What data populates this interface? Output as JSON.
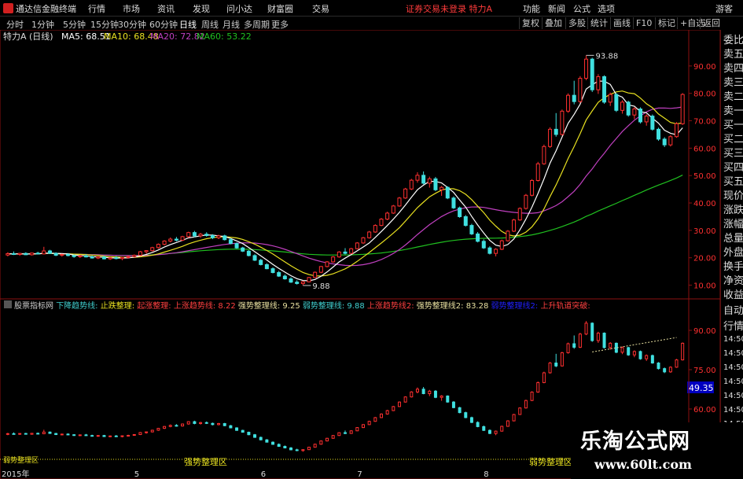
{
  "app": {
    "name": "通达信金融终端",
    "login_warning": "证券交易未登录 特力A"
  },
  "menu": [
    "行情",
    "市场",
    "资讯",
    "发现",
    "问小达",
    "财富圈",
    "交易"
  ],
  "menu_right": [
    "功能",
    "新闻",
    "公式",
    "选项",
    "游客"
  ],
  "periods": [
    "分时",
    "1分钟",
    "5分钟",
    "15分钟",
    "30分钟",
    "60分钟",
    "日线",
    "周线",
    "月线",
    "多周期",
    "更多"
  ],
  "active_period": "日线",
  "toolbar_right": [
    "复权",
    "叠加",
    "多股",
    "统计",
    "画线",
    "F10",
    "标记",
    "+自选",
    "返回"
  ],
  "right_panel": [
    "委比",
    "卖五",
    "卖四",
    "卖三",
    "卖二",
    "卖一",
    "买一",
    "买二",
    "买三",
    "买四",
    "买五",
    "现价",
    "涨跌",
    "涨幅",
    "总量",
    "外盘",
    "换手",
    "净资",
    "收益",
    "自动",
    "行情",
    "14:50",
    "14:50",
    "14:50",
    "14:50",
    "14:50",
    "14:50",
    "14:50",
    "14:50"
  ],
  "main_legend": {
    "stock": "特力A",
    "period": "(日线)",
    "ma5": "MA5: 68.51",
    "ma10": "MA10: 68.48",
    "ma20": "MA20: 72.82",
    "ma60": "MA60: 53.22"
  },
  "sub_legend": [
    {
      "text": "股票指标网",
      "color": "#c8c8c8"
    },
    {
      "text": "下降趋势线: ",
      "color": "#40d0d0"
    },
    {
      "text": "止跌整理: ",
      "color": "#e8e020"
    },
    {
      "text": "起涨整理: ",
      "color": "#ff4040"
    },
    {
      "text": "上涨趋势线: 8.22",
      "color": "#ff4040"
    },
    {
      "text": "强势整理线: 9.25",
      "color": "#e8e0a0"
    },
    {
      "text": "弱势整理线: 9.88",
      "color": "#40d0d0"
    },
    {
      "text": "上涨趋势线2: ",
      "color": "#ff4040"
    },
    {
      "text": "强势整理线2: 83.28",
      "color": "#e8e0a0"
    },
    {
      "text": "弱势整理线2: ",
      "color": "#2020ff"
    },
    {
      "text": "上升轨道突破: ",
      "color": "#ff4040"
    }
  ],
  "sub_labels": {
    "left_bottom": "弱势整理区",
    "mid_bottom": "强势整理区",
    "right_bottom": "弱势整理区",
    "value_box": "49.35"
  },
  "watermark": {
    "title": "乐淘公式网",
    "url": "www.60lt.com"
  },
  "colors": {
    "up": "#ff3030",
    "down": "#40e0e0",
    "ma5": "#ffffff",
    "ma10": "#e8e020",
    "ma20": "#c040c0",
    "ma60": "#20c020",
    "axis": "#8b1010",
    "axis_text": "#ff3030"
  },
  "chart_data": {
    "type": "candlestick",
    "main": {
      "y_ticks": [
        10,
        20,
        30,
        40,
        50,
        60,
        70,
        80,
        90
      ],
      "ylim": [
        7,
        98
      ],
      "annotations": [
        {
          "label": "93.88",
          "x": 96,
          "y": 93.88
        },
        {
          "label": "9.88",
          "x": 49,
          "y": 9.88
        }
      ],
      "ohlc": [
        [
          21,
          22,
          20.5,
          21.5
        ],
        [
          21.5,
          22.3,
          21,
          21.2
        ],
        [
          21.2,
          21.8,
          20.7,
          21.6
        ],
        [
          21.6,
          22,
          21,
          21.1
        ],
        [
          21.1,
          21.9,
          20.8,
          21.7
        ],
        [
          21.7,
          22.2,
          21.2,
          21.4
        ],
        [
          21.4,
          24,
          21.2,
          22.5
        ],
        [
          22.5,
          22.9,
          21.4,
          21.6
        ],
        [
          21.6,
          22,
          20.6,
          20.9
        ],
        [
          20.9,
          21.5,
          20.4,
          21.2
        ],
        [
          21.2,
          21.7,
          20.5,
          20.8
        ],
        [
          20.8,
          21.2,
          20,
          20.4
        ],
        [
          20.4,
          21,
          19.9,
          20.7
        ],
        [
          20.7,
          21.3,
          20.1,
          20.3
        ],
        [
          20.3,
          20.8,
          19.7,
          19.9
        ],
        [
          19.9,
          20.6,
          19.5,
          20.3
        ],
        [
          20.3,
          20.7,
          19.4,
          19.6
        ],
        [
          19.6,
          20.3,
          19.2,
          20
        ],
        [
          20,
          20.6,
          19.4,
          19.7
        ],
        [
          19.7,
          20.3,
          19.1,
          20.1
        ],
        [
          20.1,
          20.8,
          19.7,
          20.4
        ],
        [
          20.4,
          21.2,
          20.1,
          20.9
        ],
        [
          20.9,
          22.5,
          20.6,
          22.2
        ],
        [
          22.2,
          22.8,
          21.5,
          22.6
        ],
        [
          22.6,
          24,
          22.3,
          23.7
        ],
        [
          23.7,
          25.2,
          23.3,
          24.9
        ],
        [
          24.9,
          26.4,
          24.5,
          26.1
        ],
        [
          26.1,
          27.4,
          25.6,
          26.8
        ],
        [
          26.8,
          27.6,
          26,
          26.4
        ],
        [
          26.4,
          28,
          26.1,
          27.7
        ],
        [
          27.7,
          29.5,
          27.3,
          29.2
        ],
        [
          29.2,
          29.8,
          27.5,
          28
        ],
        [
          28,
          29.1,
          27.3,
          28.6
        ],
        [
          28.6,
          29.3,
          27.7,
          28.1
        ],
        [
          28.1,
          28.6,
          26.8,
          27.3
        ],
        [
          27.3,
          28.4,
          26.8,
          28
        ],
        [
          28,
          28.4,
          26.3,
          26.6
        ],
        [
          26.6,
          27.1,
          24.9,
          25.2
        ],
        [
          25.2,
          25.6,
          23.3,
          23.6
        ],
        [
          23.6,
          24,
          22.1,
          22.4
        ],
        [
          22.4,
          22.8,
          20.5,
          20.8
        ],
        [
          20.8,
          21.3,
          18.8,
          19.1
        ],
        [
          19.1,
          19.6,
          17.2,
          17.5
        ],
        [
          17.5,
          18,
          15.8,
          16
        ],
        [
          16,
          16.5,
          14.3,
          14.6
        ],
        [
          14.6,
          15.2,
          13,
          13.3
        ],
        [
          13.3,
          13.9,
          12,
          12.3
        ],
        [
          12.3,
          12.9,
          10.8,
          11.1
        ],
        [
          11.1,
          11.8,
          10.2,
          10.6
        ],
        [
          10.6,
          11.5,
          9.88,
          11.2
        ],
        [
          11.2,
          13,
          11,
          12.8
        ],
        [
          12.8,
          15,
          12.6,
          14.7
        ],
        [
          14.7,
          17,
          14.4,
          16.8
        ],
        [
          16.8,
          18.8,
          16.5,
          18.5
        ],
        [
          18.5,
          20.6,
          18.2,
          20.3
        ],
        [
          20.3,
          22.4,
          20,
          22.1
        ],
        [
          22.1,
          23.5,
          21.2,
          21.6
        ],
        [
          21.6,
          23.6,
          21.4,
          23.3
        ],
        [
          23.3,
          25.7,
          23.1,
          25.4
        ],
        [
          25.4,
          27.6,
          25.1,
          27.3
        ],
        [
          27.3,
          29.8,
          27,
          29.4
        ],
        [
          29.4,
          32.2,
          29.1,
          31.8
        ],
        [
          31.8,
          34.5,
          31.5,
          34.1
        ],
        [
          34.1,
          36.8,
          33.7,
          36.3
        ],
        [
          36.3,
          39.3,
          36,
          38.9
        ],
        [
          38.9,
          42.2,
          38.6,
          41.8
        ],
        [
          41.8,
          45.5,
          41.5,
          45.1
        ],
        [
          45.1,
          48.8,
          44.7,
          48.3
        ],
        [
          48.3,
          51.2,
          47.4,
          50.1
        ],
        [
          50.1,
          51.5,
          46.8,
          47.2
        ],
        [
          47.2,
          49.6,
          45.6,
          48.8
        ],
        [
          48.8,
          49.5,
          44.3,
          44.8
        ],
        [
          44.8,
          46.2,
          42.6,
          45.7
        ],
        [
          45.7,
          46.1,
          41.4,
          41.8
        ],
        [
          41.8,
          42.4,
          37.8,
          38.2
        ],
        [
          38.2,
          38.7,
          34.6,
          35
        ],
        [
          35,
          35.6,
          31.4,
          31.8
        ],
        [
          31.8,
          32.4,
          28.3,
          28.7
        ],
        [
          28.7,
          29.4,
          25.6,
          26
        ],
        [
          26,
          26.7,
          23.2,
          23.6
        ],
        [
          23.6,
          24.2,
          21.2,
          21.6
        ],
        [
          21.6,
          23.5,
          20.5,
          23.1
        ],
        [
          23.1,
          26.6,
          22.8,
          26.2
        ],
        [
          26.2,
          30.1,
          25.9,
          29.7
        ],
        [
          29.7,
          34.2,
          29.4,
          33.8
        ],
        [
          33.8,
          38.4,
          33.5,
          38
        ],
        [
          38,
          43.3,
          37.6,
          42.8
        ],
        [
          42.8,
          48.7,
          42.4,
          48.2
        ],
        [
          48.2,
          55,
          47.8,
          54.3
        ],
        [
          54.3,
          61.3,
          53.9,
          60.6
        ],
        [
          60.6,
          67.6,
          60.1,
          66.9
        ],
        [
          66.9,
          72.8,
          64.2,
          65
        ],
        [
          65,
          74.1,
          64.6,
          73.5
        ],
        [
          73.5,
          80,
          72.9,
          79.3
        ],
        [
          79.3,
          84.6,
          76,
          77
        ],
        [
          77,
          86.3,
          76.5,
          85.5
        ],
        [
          85.5,
          93.88,
          84.8,
          92.5
        ],
        [
          92.5,
          93,
          80.5,
          81.3
        ],
        [
          81.3,
          87,
          79.8,
          86.1
        ],
        [
          86.1,
          86.6,
          76.2,
          76.8
        ],
        [
          76.8,
          80.3,
          75.4,
          79.6
        ],
        [
          79.6,
          80.1,
          73.2,
          73.8
        ],
        [
          73.8,
          77.5,
          72.6,
          76.8
        ],
        [
          76.8,
          77.3,
          71.5,
          72.1
        ],
        [
          72.1,
          75,
          70.6,
          74.3
        ],
        [
          74.3,
          74.9,
          69,
          69.6
        ],
        [
          69.6,
          72.4,
          68.2,
          71.7
        ],
        [
          71.7,
          72.3,
          66.4,
          66.9
        ],
        [
          66.9,
          67.5,
          62.7,
          63.3
        ],
        [
          63.3,
          64,
          60.4,
          61.2
        ],
        [
          61.2,
          64.8,
          60.6,
          64.2
        ],
        [
          64.2,
          69.5,
          63.8,
          68.9
        ],
        [
          68.9,
          80.1,
          68.5,
          79.6
        ]
      ]
    },
    "sub": {
      "y_ticks": [
        45,
        60,
        75,
        90
      ],
      "ylim": [
        42,
        96
      ],
      "trend_line": {
        "from": [
          97,
          74
        ],
        "to": [
          111,
          83.28
        ]
      }
    },
    "x_labels": [
      {
        "label": "2015年",
        "x": 0
      },
      {
        "label": "5",
        "x": 21
      },
      {
        "label": "6",
        "x": 42
      },
      {
        "label": "7",
        "x": 58
      },
      {
        "label": "8",
        "x": 79
      },
      {
        "label": "9",
        "x": 100
      },
      {
        "label": "10",
        "x": 110
      }
    ]
  }
}
